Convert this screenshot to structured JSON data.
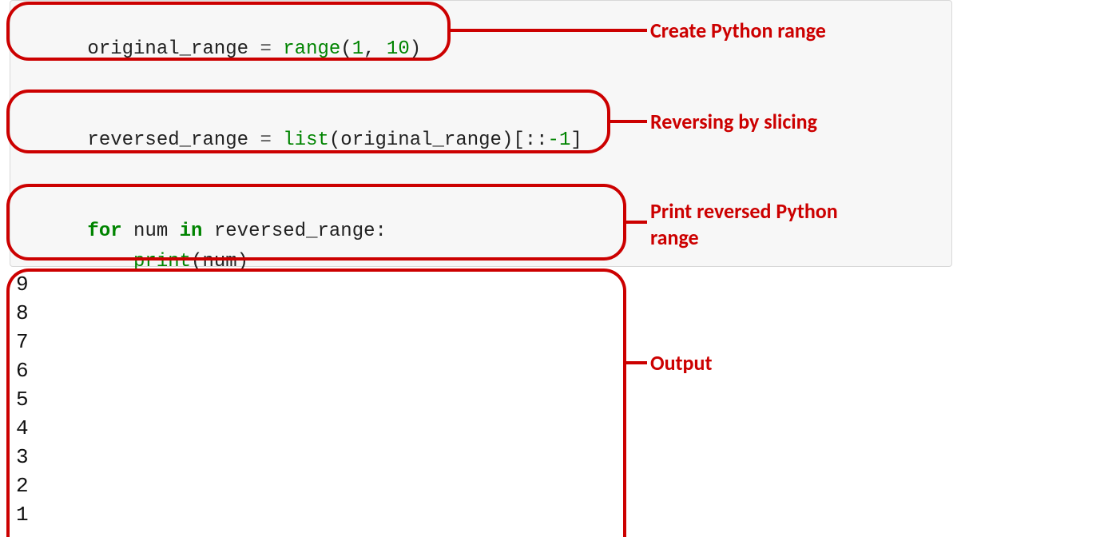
{
  "code": {
    "line1": {
      "var": "original_range",
      "assign": " = ",
      "fn": "range",
      "open": "(",
      "arg1": "1",
      "comma": ", ",
      "arg2": "10",
      "close": ")"
    },
    "line2": {
      "var": "reversed_range",
      "assign": " = ",
      "fn": "list",
      "open": "(",
      "inner": "original_range",
      "close": ")[::",
      "neg1": "-1",
      "close2": "]"
    },
    "line3": {
      "for": "for",
      "sp1": " num ",
      "in": "in",
      "rest": " reversed_range:"
    },
    "line4": {
      "indent": "    ",
      "print": "print",
      "rest": "(num)"
    }
  },
  "annotations": {
    "create": "Create Python range",
    "reverse": "Reversing by slicing",
    "print": "Print reversed Python\nrange",
    "output": "Output"
  },
  "output": [
    "9",
    "8",
    "7",
    "6",
    "5",
    "4",
    "3",
    "2",
    "1"
  ]
}
